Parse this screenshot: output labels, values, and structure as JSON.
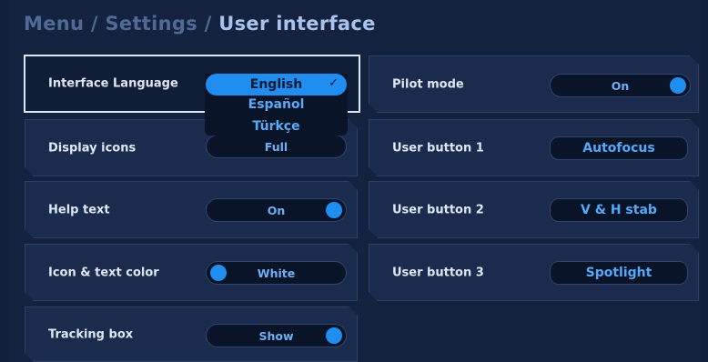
{
  "breadcrumb": {
    "item1": "Menu",
    "sep1": "/",
    "item2": "Settings",
    "sep2": "/",
    "current": "User interface"
  },
  "settings_left": {
    "interface_language": {
      "label": "Interface Language",
      "selected": "English",
      "options": [
        "English",
        "Español",
        "Türkçe"
      ]
    },
    "display_icons": {
      "label": "Display icons",
      "value": "Full"
    },
    "help_text": {
      "label": "Help text",
      "value": "On"
    },
    "icon_text_color": {
      "label": "Icon & text color",
      "value": "White"
    },
    "tracking_box": {
      "label": "Tracking box",
      "value": "Show"
    }
  },
  "settings_right": {
    "pilot_mode": {
      "label": "Pilot mode",
      "value": "On"
    },
    "user_button_1": {
      "label": "User button 1",
      "value": "Autofocus"
    },
    "user_button_2": {
      "label": "User button 2",
      "value": "V & H stab"
    },
    "user_button_3": {
      "label": "User button 3",
      "value": "Spotlight"
    }
  },
  "icons": {
    "checkmark": "check-icon"
  },
  "colors": {
    "background": "#14223f",
    "tile": "#1b2b4d",
    "accent": "#1f8ef0",
    "value_text": "#56a9f5",
    "label_text": "#dde7f3",
    "breadcrumb_dim": "#4f6a95",
    "breadcrumb_current": "#a9c4ec"
  }
}
